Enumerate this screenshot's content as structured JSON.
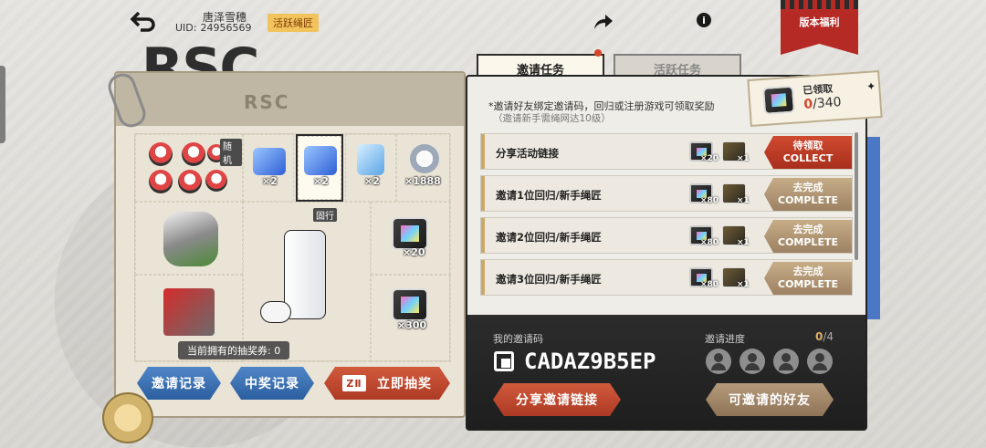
{
  "header": {
    "user_name": "唐泽雪穗",
    "uid_label": "UID:",
    "uid_value": "24956569",
    "title_badge": "活跃绳匠",
    "version_ribbon": "版本福利"
  },
  "logo_text": "RSC",
  "prize_pool": {
    "random_tag": "随机",
    "fixed_tag": "固行",
    "items": [
      {
        "icon": "bunny-doll-set",
        "qty": ""
      },
      {
        "icon": "blue-gem-pack",
        "qty": "×2"
      },
      {
        "icon": "blue-gem-box",
        "qty": "×2"
      },
      {
        "icon": "blue-crystal",
        "qty": "×2"
      },
      {
        "icon": "silver-coin",
        "qty": "×1888"
      },
      {
        "icon": "character-figure",
        "qty": ""
      },
      {
        "icon": "game-console",
        "qty": ""
      },
      {
        "icon": "film-ticket",
        "qty": "×20"
      },
      {
        "icon": "red-box",
        "qty": ""
      },
      {
        "icon": "film-ticket",
        "qty": "×300"
      }
    ],
    "ticket_count_label": "当前拥有的抽奖券: 0"
  },
  "left_buttons": {
    "invite_record": "邀请记录",
    "prize_record": "中奖记录",
    "draw_badge": "ZⅡ",
    "draw_now": "立即抽奖"
  },
  "tabs": [
    {
      "label": "邀请任务",
      "active": true
    },
    {
      "label": "活跃任务",
      "active": false
    }
  ],
  "notes": {
    "line1": "*邀请好友绑定邀请码，回归或注册游戏可领取奖励",
    "line2": "（邀请新手需绳网达10级）"
  },
  "claimed": {
    "label": "已领取",
    "current": "0",
    "total": "/340"
  },
  "tasks": [
    {
      "label": "分享活动链接",
      "reward1": "×20",
      "reward2": "×1",
      "btn_cn": "待领取",
      "btn_en": "COLLECT",
      "state": "collect"
    },
    {
      "label": "邀请1位回归/新手绳匠",
      "reward1": "×80",
      "reward2": "×1",
      "btn_cn": "去完成",
      "btn_en": "COMPLETE",
      "state": "complete"
    },
    {
      "label": "邀请2位回归/新手绳匠",
      "reward1": "×80",
      "reward2": "×1",
      "btn_cn": "去完成",
      "btn_en": "COMPLETE",
      "state": "complete"
    },
    {
      "label": "邀请3位回归/新手绳匠",
      "reward1": "×80",
      "reward2": "×1",
      "btn_cn": "去完成",
      "btn_en": "COMPLETE",
      "state": "complete"
    }
  ],
  "invite": {
    "code_label": "我的邀请码",
    "code": "CADAZ9B5EP",
    "progress_label": "邀请进度",
    "progress_current": "0",
    "progress_total": "/4",
    "share_button": "分享邀请链接",
    "friends_button": "可邀请的好友"
  },
  "colors": {
    "accent_red": "#b52a25",
    "accent_blue": "#2c5e9e",
    "accent_tan": "#9c8263",
    "highlight_orange": "#d2462b"
  }
}
